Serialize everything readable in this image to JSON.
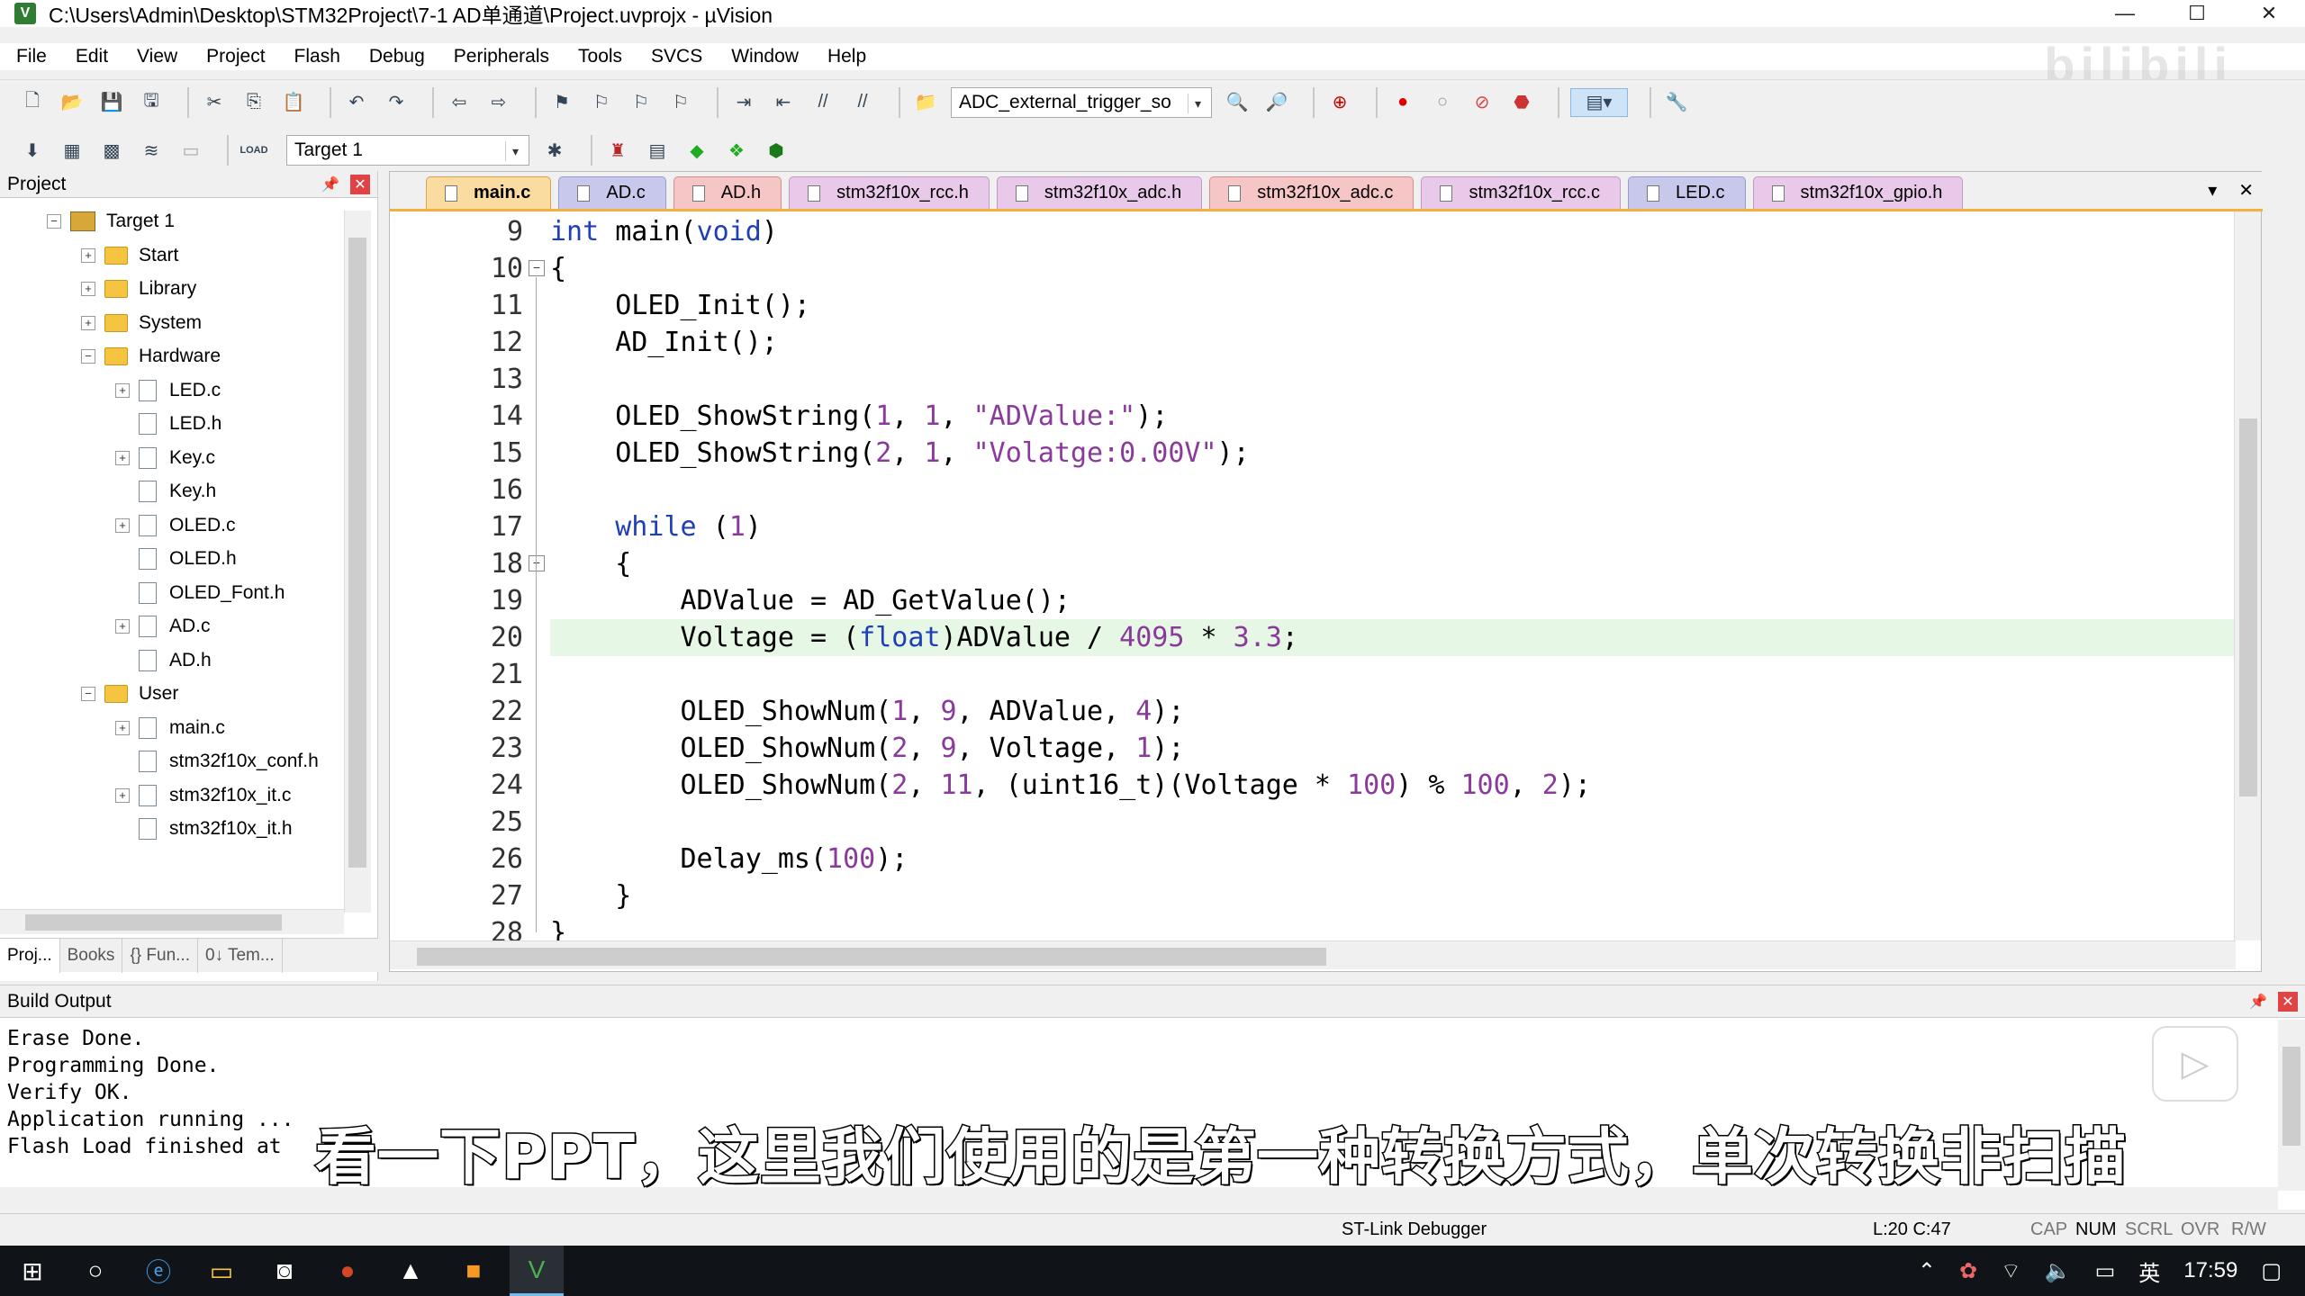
{
  "window": {
    "title": "C:\\Users\\Admin\\Desktop\\STM32Project\\7-1 AD单通道\\Project.uvprojx - µVision",
    "minimize": "—",
    "maximize": "☐",
    "close": "✕"
  },
  "menu": [
    "File",
    "Edit",
    "View",
    "Project",
    "Flash",
    "Debug",
    "Peripherals",
    "Tools",
    "SVCS",
    "Window",
    "Help"
  ],
  "watermark": "bilibili",
  "toolbar1": {
    "combo_value": "ADC_external_trigger_so"
  },
  "toolbar2": {
    "target_value": "Target 1",
    "load_label": "LOAD"
  },
  "project_panel": {
    "title": "Project",
    "tree": [
      {
        "label": "Target 1",
        "type": "target",
        "level": 0,
        "expander": "−"
      },
      {
        "label": "Start",
        "type": "folder",
        "level": 1,
        "expander": "+"
      },
      {
        "label": "Library",
        "type": "folder",
        "level": 1,
        "expander": "+"
      },
      {
        "label": "System",
        "type": "folder",
        "level": 1,
        "expander": "+"
      },
      {
        "label": "Hardware",
        "type": "folder",
        "level": 1,
        "expander": "−"
      },
      {
        "label": "LED.c",
        "type": "file",
        "level": 2,
        "expander": "+"
      },
      {
        "label": "LED.h",
        "type": "file",
        "level": 2,
        "expander": ""
      },
      {
        "label": "Key.c",
        "type": "file",
        "level": 2,
        "expander": "+"
      },
      {
        "label": "Key.h",
        "type": "file",
        "level": 2,
        "expander": ""
      },
      {
        "label": "OLED.c",
        "type": "file",
        "level": 2,
        "expander": "+"
      },
      {
        "label": "OLED.h",
        "type": "file",
        "level": 2,
        "expander": ""
      },
      {
        "label": "OLED_Font.h",
        "type": "file",
        "level": 2,
        "expander": ""
      },
      {
        "label": "AD.c",
        "type": "file",
        "level": 2,
        "expander": "+"
      },
      {
        "label": "AD.h",
        "type": "file",
        "level": 2,
        "expander": ""
      },
      {
        "label": "User",
        "type": "folder",
        "level": 1,
        "expander": "−"
      },
      {
        "label": "main.c",
        "type": "file",
        "level": 2,
        "expander": "+"
      },
      {
        "label": "stm32f10x_conf.h",
        "type": "file",
        "level": 2,
        "expander": ""
      },
      {
        "label": "stm32f10x_it.c",
        "type": "file",
        "level": 2,
        "expander": "+"
      },
      {
        "label": "stm32f10x_it.h",
        "type": "file",
        "level": 2,
        "expander": ""
      }
    ],
    "bottom_tabs": [
      "Proj...",
      "Books",
      "{} Fun...",
      "0↓ Tem..."
    ]
  },
  "editor": {
    "tabs": [
      {
        "label": "main.c",
        "kind": "active"
      },
      {
        "label": "AD.c",
        "kind": "h"
      },
      {
        "label": "AD.h",
        "kind": "rcc"
      },
      {
        "label": "stm32f10x_rcc.h",
        "kind": "c"
      },
      {
        "label": "stm32f10x_adc.h",
        "kind": "c"
      },
      {
        "label": "stm32f10x_adc.c",
        "kind": "rcc"
      },
      {
        "label": "stm32f10x_rcc.c",
        "kind": "c"
      },
      {
        "label": "LED.c",
        "kind": "h"
      },
      {
        "label": "stm32f10x_gpio.h",
        "kind": "c"
      }
    ],
    "highlighted_line": 20,
    "lines": [
      {
        "n": "9",
        "html": "<span class=\"kw\">int</span> main(<span class=\"kw\">void</span>)"
      },
      {
        "n": "10",
        "html": "{"
      },
      {
        "n": "11",
        "html": "    OLED_Init();"
      },
      {
        "n": "12",
        "html": "    AD_Init();"
      },
      {
        "n": "13",
        "html": ""
      },
      {
        "n": "14",
        "html": "    OLED_ShowString(<span class=\"num\">1</span>, <span class=\"num\">1</span>, <span class=\"str\">\"ADValue:\"</span>);"
      },
      {
        "n": "15",
        "html": "    OLED_ShowString(<span class=\"num\">2</span>, <span class=\"num\">1</span>, <span class=\"str\">\"Volatge:0.00V\"</span>);"
      },
      {
        "n": "16",
        "html": ""
      },
      {
        "n": "17",
        "html": "    <span class=\"kw\">while</span> (<span class=\"num\">1</span>)"
      },
      {
        "n": "18",
        "html": "    {"
      },
      {
        "n": "19",
        "html": "        ADValue = AD_GetValue();"
      },
      {
        "n": "20",
        "html": "        Voltage = (<span class=\"kw\">float</span>)ADValue / <span class=\"num\">4095</span> * <span class=\"num\">3.3</span>;"
      },
      {
        "n": "21",
        "html": ""
      },
      {
        "n": "22",
        "html": "        OLED_ShowNum(<span class=\"num\">1</span>, <span class=\"num\">9</span>, ADValue, <span class=\"num\">4</span>);"
      },
      {
        "n": "23",
        "html": "        OLED_ShowNum(<span class=\"num\">2</span>, <span class=\"num\">9</span>, Voltage, <span class=\"num\">1</span>);"
      },
      {
        "n": "24",
        "html": "        OLED_ShowNum(<span class=\"num\">2</span>, <span class=\"num\">11</span>, (uint16_t)(Voltage * <span class=\"num\">100</span>) % <span class=\"num\">100</span>, <span class=\"num\">2</span>);"
      },
      {
        "n": "25",
        "html": ""
      },
      {
        "n": "26",
        "html": "        Delay_ms(<span class=\"num\">100</span>);"
      },
      {
        "n": "27",
        "html": "    }"
      },
      {
        "n": "28",
        "html": "}"
      }
    ]
  },
  "build_output": {
    "title": "Build Output",
    "lines": [
      "Erase Done.",
      "Programming Done.",
      "Verify OK.",
      "Application running ...",
      "Flash Load finished at"
    ]
  },
  "subtitle": "看一下PPT，这里我们使用的是第一种转换方式，单次转换非扫描",
  "statusbar": {
    "debugger": "ST-Link Debugger",
    "position": "L:20 C:47",
    "caps": "CAP",
    "num": "NUM",
    "scrl": "SCRL",
    "ovr": "OVR",
    "rw": "R/W"
  },
  "taskbar": {
    "time": "17:59",
    "ime": "英"
  }
}
